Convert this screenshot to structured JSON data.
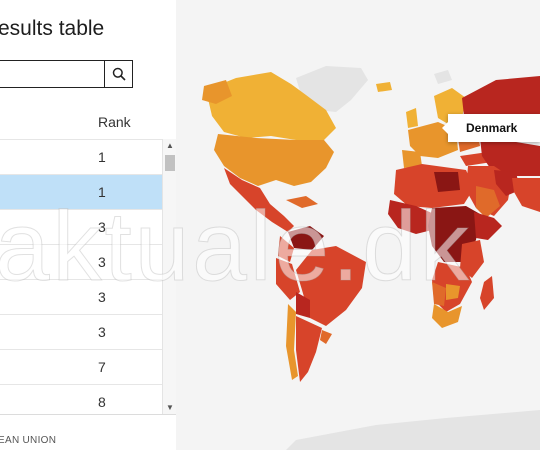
{
  "panel": {
    "title": "esults table",
    "search": {
      "value": "",
      "placeholder": ""
    },
    "column_header": "Rank",
    "rows": [
      {
        "rank": "1",
        "selected": false
      },
      {
        "rank": "1",
        "selected": true
      },
      {
        "rank": "3",
        "selected": false
      },
      {
        "rank": "3",
        "selected": false
      },
      {
        "rank": "3",
        "selected": false
      },
      {
        "rank": "3",
        "selected": false
      },
      {
        "rank": "7",
        "selected": false
      },
      {
        "rank": "8",
        "selected": false
      }
    ],
    "footer": "EAN UNION"
  },
  "map": {
    "tooltip": "Denmark",
    "legend_colors": [
      "#f0b135",
      "#e8952c",
      "#e06a2a",
      "#d7442a",
      "#b8261f",
      "#8a1614"
    ]
  },
  "watermark": "aktuale.dk"
}
